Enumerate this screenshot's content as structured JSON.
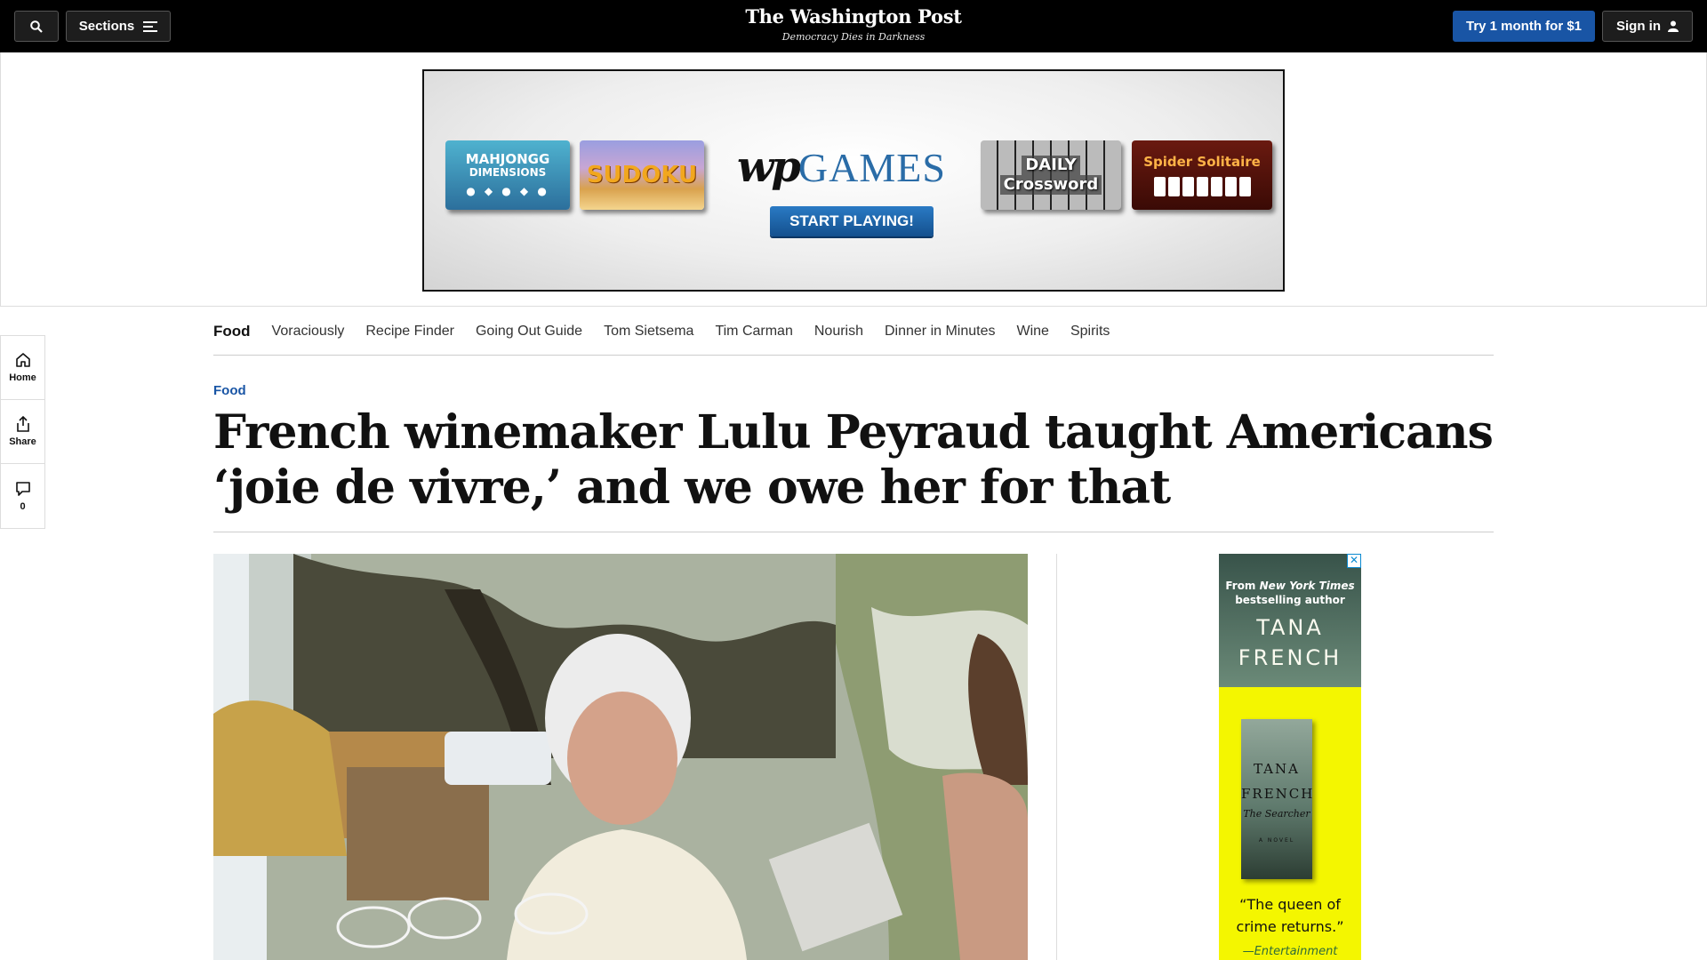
{
  "header": {
    "sections_label": "Sections",
    "logo": "The Washington Post",
    "tagline": "Democracy Dies in Darkness",
    "subscribe_label": "Try 1 month for $1",
    "signin_label": "Sign in"
  },
  "banner_ad": {
    "mahjongg_line1": "MAHJONGG",
    "mahjongg_line2": "DIMENSIONS",
    "sudoku": "SUDOKU",
    "brand_wp": "wp",
    "brand_games": "GAMES",
    "cta": "START PLAYING!",
    "crossword_line1": "DAILY",
    "crossword_line2": "Crossword",
    "spider": "Spider Solitaire"
  },
  "rail": {
    "home": "Home",
    "share": "Share",
    "comments_count": "0"
  },
  "subnav": {
    "items": [
      "Food",
      "Voraciously",
      "Recipe Finder",
      "Going Out Guide",
      "Tom Sietsema",
      "Tim Carman",
      "Nourish",
      "Dinner in Minutes",
      "Wine",
      "Spirits"
    ]
  },
  "article": {
    "kicker": "Food",
    "headline": "French winemaker Lulu Peyraud taught Americans ‘joie de vivre,’ and we owe her for that"
  },
  "side_ad": {
    "from_line1": "From",
    "from_italic": "New York Times",
    "from_line2": "bestselling author",
    "author_first": "TANA",
    "author_last": "FRENCH",
    "book_first": "TANA",
    "book_last": "FRENCH",
    "book_title": "The Searcher",
    "book_note": "A NOVEL",
    "quote": "“The queen of crime returns.”",
    "source": "—Entertainment"
  },
  "colors": {
    "accent": "#1955a5",
    "topbar": "#000000",
    "ad_yellow": "#f4f600"
  }
}
